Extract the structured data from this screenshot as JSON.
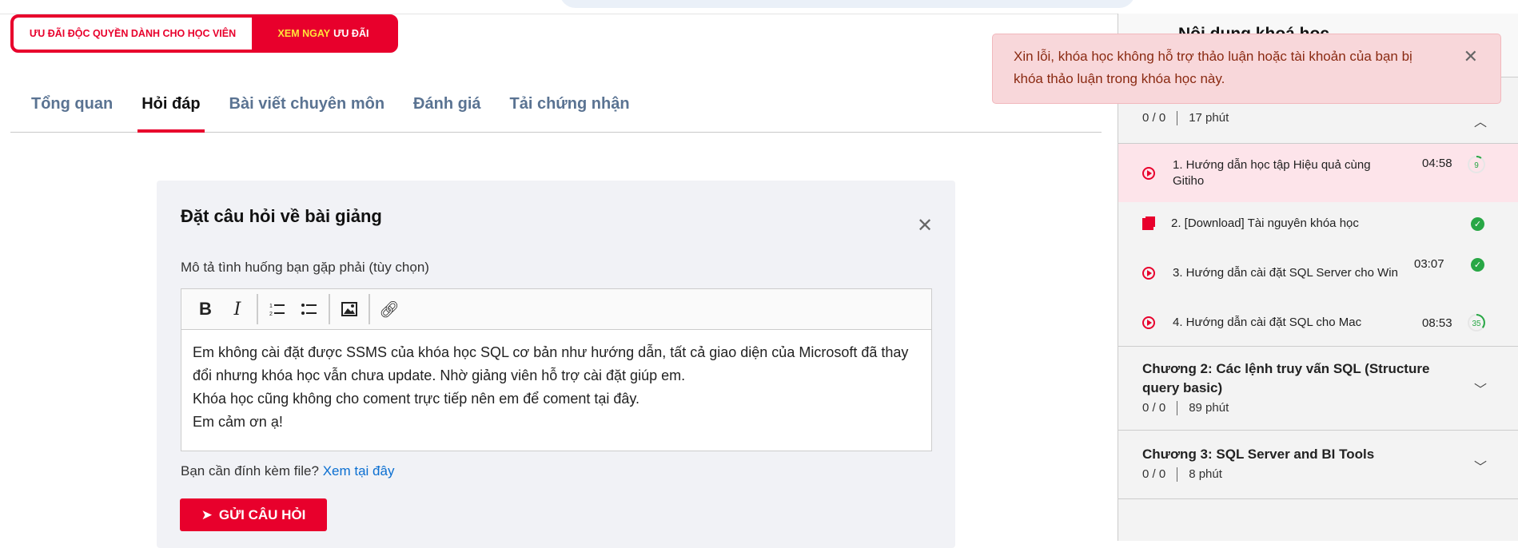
{
  "promo": {
    "left_label": "ƯU ĐÃI ĐỘC QUYỀN DÀNH CHO HỌC VIÊN",
    "cta_highlight": "XEM NGAY",
    "cta_rest": "ƯU ĐÃI"
  },
  "tabs": [
    "Tổng quan",
    "Hỏi đáp",
    "Bài viết chuyên môn",
    "Đánh giá",
    "Tải chứng nhận"
  ],
  "active_tab": "Hỏi đáp",
  "form": {
    "title": "Đặt câu hỏi về bài giảng",
    "label": "Mô tả tình huống bạn gặp phải (tùy chọn)",
    "toolbar": {
      "bold": "B",
      "italic": "I"
    },
    "content_lines": [
      "Em không cài đặt được SSMS của khóa học SQL cơ bản như hướng dẫn, tất cả giao diện của Microsoft đã thay đổi nhưng khóa học vẫn chưa update. Nhờ giảng viên hỗ trợ cài đặt giúp em.",
      "Khóa học cũng không cho coment trực tiếp nên em để coment tại đây.",
      "Em cảm ơn ạ!"
    ],
    "attach_text": "Bạn cần đính kèm file?",
    "attach_link": "Xem tại đây",
    "submit": "GỬI CÂU HỎI"
  },
  "sidebar": {
    "title": "Nội dung khoá học",
    "chapter1": {
      "progress": "0 / 0",
      "duration": "17 phút"
    },
    "lessons": [
      {
        "title": "1. Hướng dẫn học tập Hiệu quả cùng Gitiho",
        "time": "04:58",
        "progress": "9",
        "type": "video"
      },
      {
        "title": "2. [Download] Tài nguyên khóa học",
        "time": "",
        "type": "file",
        "done": true
      },
      {
        "title": "3. Hướng dẫn cài đặt SQL Server cho Win",
        "time": "03:07",
        "type": "video",
        "done": true
      },
      {
        "title": "4. Hướng dẫn cài đặt SQL cho Mac",
        "time": "08:53",
        "progress": "35",
        "type": "video"
      }
    ],
    "chapters": [
      {
        "title": "Chương 2: Các lệnh truy vấn SQL (Structure query basic)",
        "progress": "0 / 0",
        "duration": "89 phút"
      },
      {
        "title": "Chương 3: SQL Server and BI Tools",
        "progress": "0 / 0",
        "duration": "8 phút"
      }
    ]
  },
  "toast": {
    "message": "Xin lỗi, khóa học không hỗ trợ thảo luận hoặc tài khoản của bạn bị khóa thảo luận trong khóa học này."
  },
  "colors": {
    "brand": "#e8002c",
    "success": "#28a745",
    "link": "#0b6fd1"
  }
}
